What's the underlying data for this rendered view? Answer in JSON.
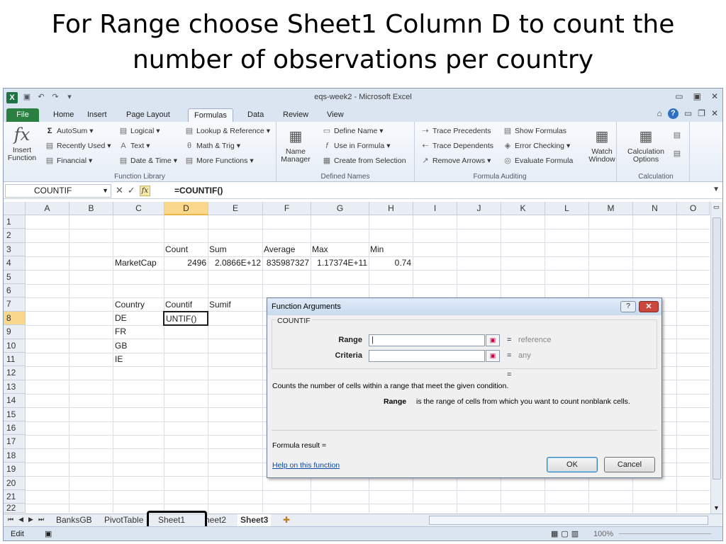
{
  "slide": {
    "title_line1": "For Range choose Sheet1 Column D to count the",
    "title_line2": "number of observations per country"
  },
  "window": {
    "title": "eqs-week2 - Microsoft Excel"
  },
  "ribbon_tabs": [
    "File",
    "Home",
    "Insert",
    "Page Layout",
    "Formulas",
    "Data",
    "Review",
    "View"
  ],
  "ribbon": {
    "insert_function": [
      "Insert",
      "Function"
    ],
    "autosum": "AutoSum",
    "recently_used": "Recently Used",
    "financial": "Financial",
    "logical": "Logical",
    "text": "Text",
    "date_time": "Date & Time",
    "lookup": "Lookup & Reference",
    "math": "Math & Trig",
    "more_functions": "More Functions",
    "group_function_library": "Function Library",
    "name_manager": [
      "Name",
      "Manager"
    ],
    "define_name": "Define Name",
    "use_in_formula": "Use in Formula",
    "create_from_selection": "Create from Selection",
    "group_defined_names": "Defined Names",
    "trace_precedents": "Trace Precedents",
    "trace_dependents": "Trace Dependents",
    "remove_arrows": "Remove Arrows",
    "show_formulas": "Show Formulas",
    "error_checking": "Error Checking",
    "evaluate_formula": "Evaluate Formula",
    "watch_window": [
      "Watch",
      "Window"
    ],
    "group_formula_auditing": "Formula Auditing",
    "calculation_options": [
      "Calculation",
      "Options"
    ],
    "group_calculation": "Calculation"
  },
  "formula_bar": {
    "name_box": "COUNTIF",
    "formula": "=COUNTIF()"
  },
  "columns": [
    "A",
    "B",
    "C",
    "D",
    "E",
    "F",
    "G",
    "H",
    "I",
    "J",
    "K",
    "L",
    "M",
    "N",
    "O"
  ],
  "rows": [
    "1",
    "2",
    "3",
    "4",
    "5",
    "6",
    "7",
    "8",
    "9",
    "10",
    "11",
    "12",
    "13",
    "14",
    "15",
    "16",
    "17",
    "18",
    "19",
    "20",
    "21",
    "22"
  ],
  "cells": {
    "D3": "Count",
    "E3": "Sum",
    "F3": "Average",
    "G3": "Max",
    "H3": "Min",
    "C4": "MarketCap",
    "D4": "2496",
    "E4": "2.0866E+12",
    "F4": "835987327",
    "G4": "1.17374E+11",
    "H4": "0.74",
    "C7": "Country",
    "D7": "Countif",
    "E7": "Sumif",
    "C8": "DE",
    "D8": "UNTIF()",
    "C9": "FR",
    "C10": "GB",
    "C11": "IE"
  },
  "sheet_tabs": [
    "BanksGB",
    "PivotTable",
    "Sheet1",
    "heet2",
    "Sheet3"
  ],
  "status": {
    "mode": "Edit",
    "zoom": "100%"
  },
  "dialog": {
    "title": "Function Arguments",
    "function_name": "COUNTIF",
    "args": [
      {
        "label": "Range",
        "value": "",
        "result": "reference"
      },
      {
        "label": "Criteria",
        "value": "",
        "result": "any"
      }
    ],
    "equals": "=",
    "description": "Counts the number of cells within a range that meet the given condition.",
    "arg_help_label": "Range",
    "arg_help_text": "is the range of cells from which you want to count nonblank cells.",
    "formula_result": "Formula result =",
    "help_link": "Help on this function",
    "ok": "OK",
    "cancel": "Cancel"
  }
}
